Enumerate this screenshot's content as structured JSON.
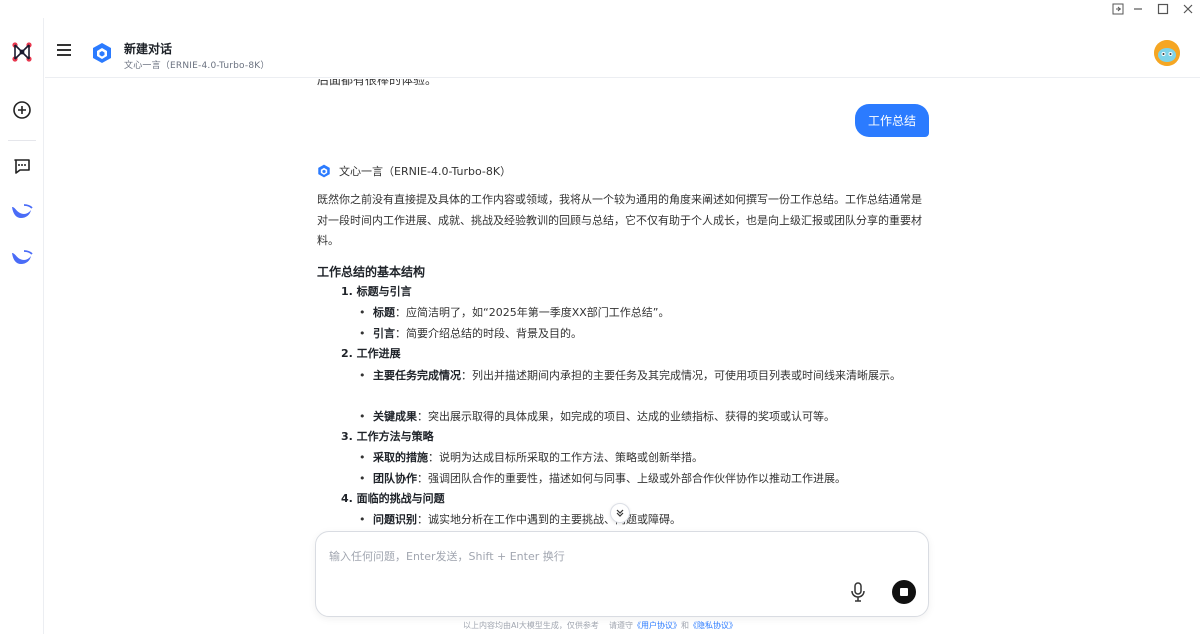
{
  "header": {
    "title": "新建对话",
    "subtitle": "文心一言（ERNIE-4.0-Turbo-8K）"
  },
  "chat": {
    "cut_text": "后面都有很棒的体验。",
    "user_message": "工作总结",
    "bot_name": "文心一言（ERNIE-4.0-Turbo-8K）",
    "intro": "既然你之前没有直接提及具体的工作内容或领域，我将从一个较为通用的角度来阐述如何撰写一份工作总结。工作总结通常是对一段时间内工作进展、成就、挑战及经验教训的回顾与总结，它不仅有助于个人成长，也是向上级汇报或团队分享的重要材料。",
    "section_heading": "工作总结的基本结构",
    "sections": [
      {
        "title": "1. 标题与引言",
        "items": [
          {
            "label": "标题",
            "text": "：应简洁明了，如“2025年第一季度XX部门工作总结”。"
          },
          {
            "label": "引言",
            "text": "：简要介绍总结的时段、背景及目的。"
          }
        ]
      },
      {
        "title": "2. 工作进展",
        "items": [
          {
            "label": "主要任务完成情况",
            "text": "：列出并描述期间内承担的主要任务及其完成情况，可使用项目列表或时间线来清晰展示。"
          },
          {
            "label": "关键成果",
            "text": "：突出展示取得的具体成果，如完成的项目、达成的业绩指标、获得的奖项或认可等。"
          }
        ]
      },
      {
        "title": "3. 工作方法与策略",
        "items": [
          {
            "label": "采取的措施",
            "text": "：说明为达成目标所采取的工作方法、策略或创新举措。"
          },
          {
            "label": "团队协作",
            "text": "：强调团队合作的重要性，描述如何与同事、上级或外部合作伙伴协作以推动工作进展。"
          }
        ]
      },
      {
        "title": "4. 面临的挑战与问题",
        "items": [
          {
            "label": "问题识别",
            "text": "：诚实地分析在工作中遇到的主要挑战、问题或障碍。"
          }
        ]
      }
    ]
  },
  "input": {
    "placeholder": "输入任何问题，Enter发送，Shift + Enter 换行"
  },
  "footer": {
    "prefix": "以上内容均由AI大模型生成，仅供参考",
    "middle": "请遵守",
    "user_agreement": "《用户协议》",
    "and": "和",
    "privacy": "《隐私协议》"
  },
  "colors": {
    "accent": "#2b7bff",
    "brand_red": "#e8384f"
  }
}
